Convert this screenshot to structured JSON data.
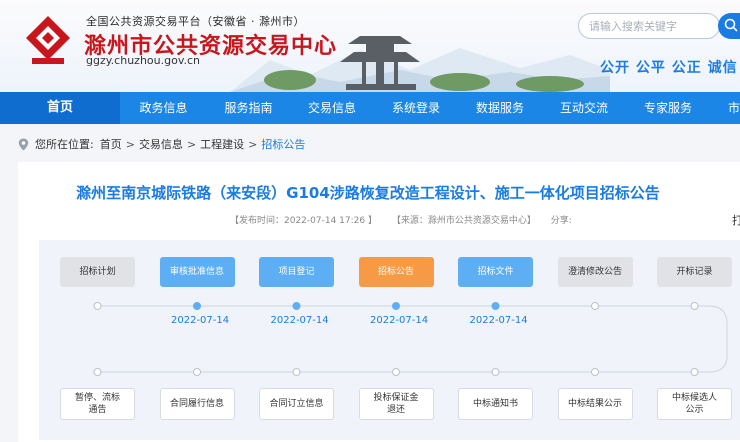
{
  "header": {
    "platform_line": "全国公共资源交易平台（安徽省 · 滁州市）",
    "site_name": "滁州市公共资源交易中心",
    "domain": "ggzy.chuzhou.gov.cn",
    "search_placeholder": "请输入搜索关键字",
    "slogan": "公开 公平 公正 诚信"
  },
  "nav": {
    "items": [
      "首页",
      "政务信息",
      "服务指南",
      "交易信息",
      "系统登录",
      "数据服务",
      "互动交流",
      "专家服务",
      "市场主体"
    ],
    "active_index": 0
  },
  "breadcrumb": {
    "prefix": "您所在位置:",
    "items": [
      "首页",
      "交易信息",
      "工程建设",
      "招标公告"
    ],
    "separator": ">"
  },
  "article": {
    "title": "滁州至南京城际铁路（来安段）G104涉路恢复改造工程设计、施工一体化项目招标公告",
    "publish_time": "【发布时间：2022-07-14 17:26 】",
    "source": "【来源：滁州市公共资源交易中心】",
    "share": "分享:",
    "print_char": "打"
  },
  "flow": {
    "top": [
      {
        "label": "招标计划",
        "state": "gray",
        "date": ""
      },
      {
        "label": "审核批准信息",
        "state": "blue",
        "date": "2022-07-14"
      },
      {
        "label": "项目登记",
        "state": "blue",
        "date": "2022-07-14"
      },
      {
        "label": "招标公告",
        "state": "orange",
        "date": "2022-07-14"
      },
      {
        "label": "招标文件",
        "state": "blue",
        "date": "2022-07-14"
      },
      {
        "label": "澄清修改公告",
        "state": "gray",
        "date": ""
      },
      {
        "label": "开标记录",
        "state": "gray",
        "date": ""
      }
    ],
    "bottom": [
      {
        "line1": "暂停、流标",
        "line2": "通告"
      },
      {
        "line1": "合同履行信息",
        "line2": ""
      },
      {
        "line1": "合同订立信息",
        "line2": ""
      },
      {
        "line1": "投标保证金",
        "line2": "退还"
      },
      {
        "line1": "中标通知书",
        "line2": ""
      },
      {
        "line1": "中标结果公示",
        "line2": ""
      },
      {
        "line1": "中标候选人",
        "line2": "公示"
      }
    ]
  },
  "colors": {
    "nav_blue": "#1b86e5",
    "accent_blue": "#1a7ce3",
    "brand_red": "#c8161d",
    "active_orange": "#f79a45",
    "done_blue": "#5eaef4"
  }
}
